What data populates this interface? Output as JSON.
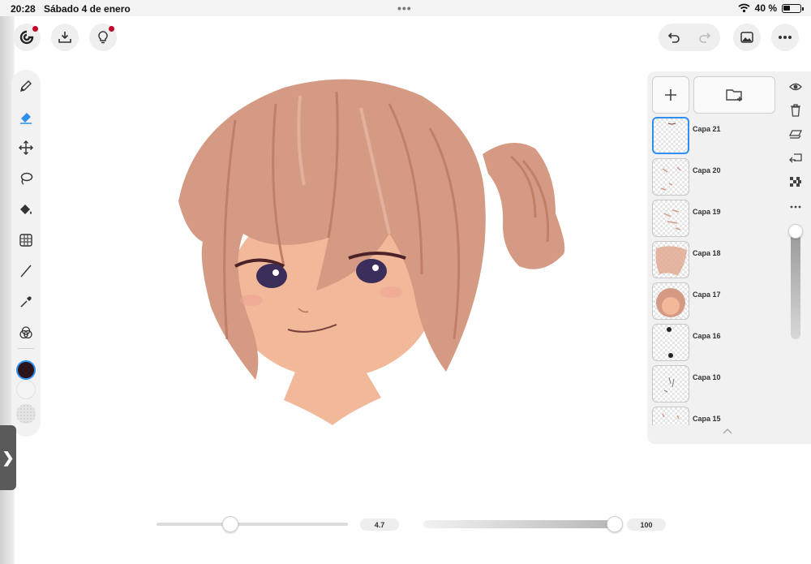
{
  "status_bar": {
    "time": "20:28",
    "date": "Sábado 4 de enero",
    "battery": "40 %"
  },
  "top_bar": {
    "left_icons": [
      "app-logo-icon",
      "import-icon",
      "lightbulb-icon"
    ],
    "right_icons": [
      "undo-icon",
      "redo-icon",
      "gallery-icon",
      "more-icon"
    ]
  },
  "toolbar": {
    "tools": [
      "pencil-icon",
      "eraser-icon",
      "move-icon",
      "lasso-icon",
      "fill-icon",
      "grid-icon",
      "line-icon",
      "eyedropper-icon",
      "color-mix-icon"
    ],
    "active_tool": "eraser-icon",
    "primary_color": "#2a1418",
    "secondary_color": "#f4f4f4"
  },
  "layers": {
    "items": [
      {
        "name": "Capa 21",
        "selected": true
      },
      {
        "name": "Capa 20",
        "selected": false
      },
      {
        "name": "Capa 19",
        "selected": false
      },
      {
        "name": "Capa 18",
        "selected": false
      },
      {
        "name": "Capa 17",
        "selected": false
      },
      {
        "name": "Capa 16",
        "selected": false
      },
      {
        "name": "Capa 10",
        "selected": false
      },
      {
        "name": "Capa 15",
        "selected": false
      }
    ]
  },
  "brush": {
    "size_value": "4.7",
    "opacity_value": "100"
  },
  "colors": {
    "accent": "#2f8ff0",
    "notification": "#c2002a",
    "hair": "#d49a84",
    "skin": "#f1b89a"
  }
}
